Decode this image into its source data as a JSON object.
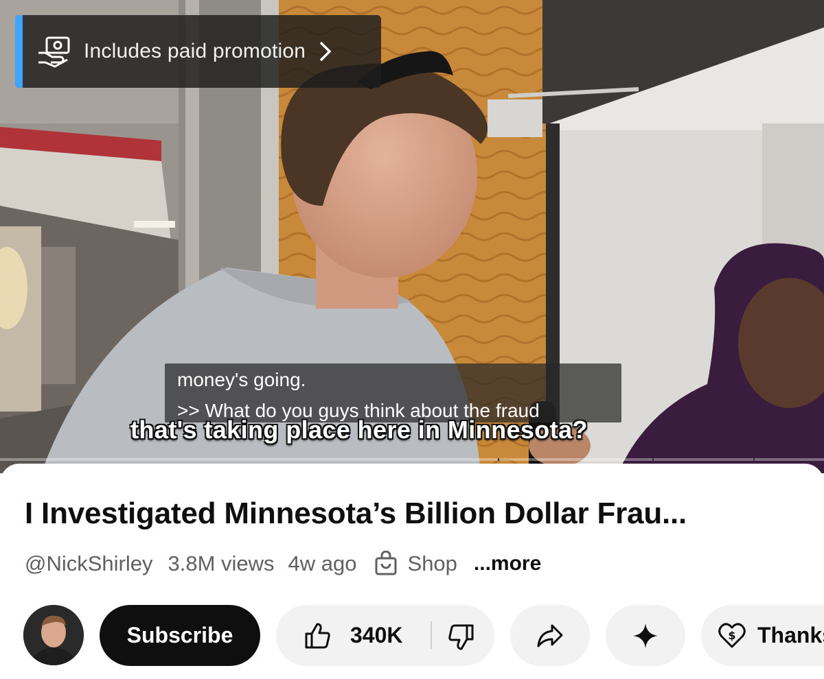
{
  "video": {
    "promo_label": "Includes paid promotion",
    "caption_line1": "money's going.",
    "caption_line2": ">> What do you guys think about the fraud",
    "burned_caption": "that's taking place here in Minnesota?"
  },
  "details": {
    "title": "I Investigated Minnesota’s Billion Dollar Frau...",
    "channel": "@NickShirley",
    "views": "3.8M views",
    "age": "4w ago",
    "shop_label": "Shop",
    "more_label": "...more"
  },
  "actions": {
    "subscribe_label": "Subscribe",
    "like_count": "340K",
    "thanks_label": "Thanks"
  },
  "colors": {
    "promo_accent": "#3ea6ff",
    "subscribe_bg": "#0f0f0f",
    "pill_bg": "#f2f2f2",
    "meta_text": "#606060"
  },
  "icons": [
    "money-icon",
    "chevron-right-icon",
    "shopping-bag-icon",
    "thumbs-up-icon",
    "thumbs-down-icon",
    "share-icon",
    "sparkle-icon",
    "super-thanks-icon"
  ]
}
